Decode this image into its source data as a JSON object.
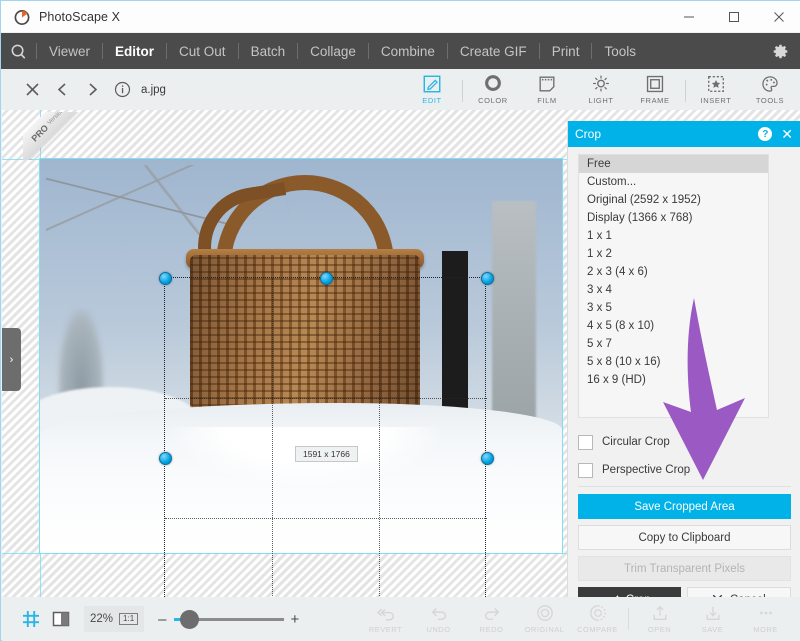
{
  "window": {
    "title": "PhotoScape X",
    "controls": [
      {
        "name": "minimize",
        "glyph": "–"
      },
      {
        "name": "maximize",
        "glyph": "☐"
      },
      {
        "name": "close",
        "glyph": "✕"
      }
    ]
  },
  "menubar": {
    "items": [
      "Viewer",
      "Editor",
      "Cut Out",
      "Batch",
      "Collage",
      "Combine",
      "Create GIF",
      "Print",
      "Tools"
    ],
    "active": "Editor",
    "settings_icon": "gear-icon"
  },
  "filebar": {
    "filename": "a.jpg",
    "icons": [
      "close-icon",
      "prev-icon",
      "next-icon",
      "info-icon"
    ]
  },
  "tabs": [
    {
      "label": "EDIT",
      "icon": "edit-icon",
      "active": true
    },
    {
      "label": "COLOR",
      "icon": "color-icon",
      "active": false
    },
    {
      "label": "FILM",
      "icon": "film-icon",
      "active": false
    },
    {
      "label": "LIGHT",
      "icon": "light-icon",
      "active": false
    },
    {
      "label": "FRAME",
      "icon": "frame-icon",
      "active": false
    },
    {
      "label": "INSERT",
      "icon": "insert-icon",
      "active": false
    },
    {
      "label": "TOOLS",
      "icon": "tools-icon",
      "active": false
    }
  ],
  "canvas": {
    "pro_badge": {
      "line1": "PRO",
      "line2": "Version"
    },
    "crop_size_label": "1591 x 1766",
    "collapse_handle": "›"
  },
  "panel": {
    "title": "Crop",
    "help_glyph": "?",
    "close_glyph": "✕",
    "ratios": [
      {
        "label": "Free",
        "selected": true
      },
      {
        "label": "Custom...",
        "selected": false
      },
      {
        "label": "Original (2592 x 1952)",
        "selected": false
      },
      {
        "label": "Display (1366 x 768)",
        "selected": false
      },
      {
        "label": "1 x 1",
        "selected": false
      },
      {
        "label": "1 x 2",
        "selected": false
      },
      {
        "label": "2 x 3 (4 x 6)",
        "selected": false
      },
      {
        "label": "3 x 4",
        "selected": false
      },
      {
        "label": "3 x 5",
        "selected": false
      },
      {
        "label": "4 x 5 (8 x 10)",
        "selected": false
      },
      {
        "label": "5 x 7",
        "selected": false
      },
      {
        "label": "5 x 8 (10 x 16)",
        "selected": false
      },
      {
        "label": "16 x 9 (HD)",
        "selected": false
      }
    ],
    "checkboxes": [
      {
        "label": "Circular Crop",
        "checked": false
      },
      {
        "label": "Perspective Crop",
        "checked": false
      }
    ],
    "buttons": {
      "save_cropped_area": "Save Cropped Area",
      "copy_to_clipboard": "Copy to Clipboard",
      "trim_transparent_pixels": "Trim Transparent Pixels",
      "crop": "Crop",
      "cancel": "Cancel"
    }
  },
  "bottombar": {
    "grid_icon": "grid-icon",
    "split_icon": "split-view-icon",
    "zoom_level": "22%",
    "one_to_one": "1:1",
    "minus": "–",
    "plus": "+",
    "actions": [
      {
        "label": "REVERT",
        "icon": "revert-icon"
      },
      {
        "label": "UNDO",
        "icon": "undo-icon"
      },
      {
        "label": "REDO",
        "icon": "redo-icon"
      },
      {
        "label": "ORIGINAL",
        "icon": "original-icon"
      },
      {
        "label": "COMPARE",
        "icon": "compare-icon"
      },
      {
        "label": "OPEN",
        "icon": "open-icon"
      },
      {
        "label": "SAVE",
        "icon": "save-icon"
      },
      {
        "label": "MORE",
        "icon": "more-icon"
      }
    ]
  },
  "colors": {
    "accent": "#00b2e8",
    "menubar_bg": "#4b4b4b",
    "arrow": "#9b59c4"
  }
}
